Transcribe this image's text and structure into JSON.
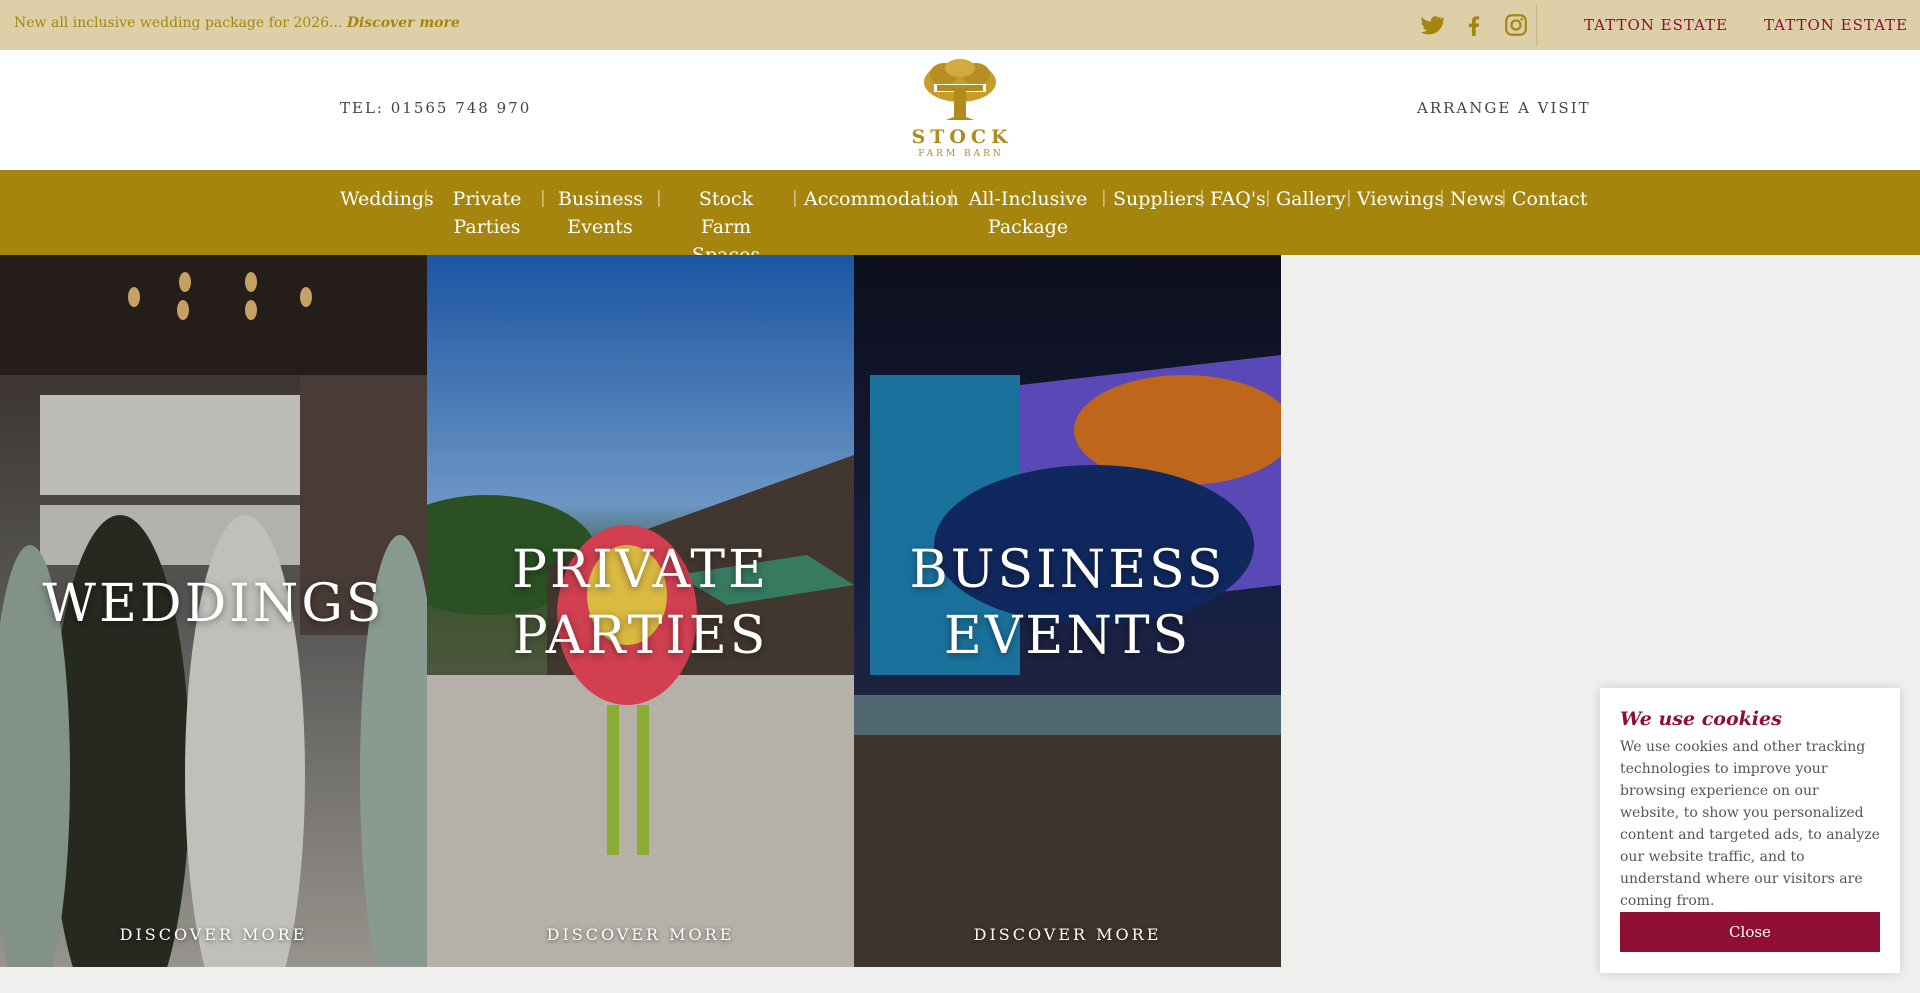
{
  "topbar": {
    "promo_text": "New all inclusive wedding package for 2026... ",
    "promo_link": "Discover more",
    "estate_links": [
      "TATTON ESTATE",
      "TATTON ESTATE"
    ]
  },
  "header": {
    "tel": "TEL: 01565 748 970",
    "arrange_visit": "ARRANGE A VISIT",
    "logo_name": "STOCK",
    "logo_sub": "FARM BARN"
  },
  "nav": {
    "items": [
      {
        "label": "Weddings"
      },
      {
        "label": "Private Parties"
      },
      {
        "label": "Business Events"
      },
      {
        "label": "Stock Farm Spaces"
      },
      {
        "label": "Accommodation"
      },
      {
        "label": "All-Inclusive Package"
      },
      {
        "label": "Suppliers"
      },
      {
        "label": "FAQ's"
      },
      {
        "label": "Gallery"
      },
      {
        "label": "Viewings"
      },
      {
        "label": "News"
      },
      {
        "label": "Contact"
      }
    ],
    "separator": "|"
  },
  "panels": [
    {
      "title": "WEDDINGS",
      "cta": "DISCOVER MORE"
    },
    {
      "title": "PRIVATE PARTIES",
      "cta": "DISCOVER MORE"
    },
    {
      "title": "BUSINESS EVENTS",
      "cta": "DISCOVER MORE"
    }
  ],
  "cookie": {
    "title": "We use cookies",
    "text": "We use cookies and other tracking technologies to improve your browsing experience on our website, to show you personalized content and targeted ads, to analyze our website traffic, and to understand where our visitors are coming from.",
    "close_label": "Close"
  },
  "colors": {
    "gold": "#a5850e",
    "topbar_bg": "#ddd0a8",
    "burgundy": "#8e0f33",
    "page_bg": "#efefed"
  }
}
